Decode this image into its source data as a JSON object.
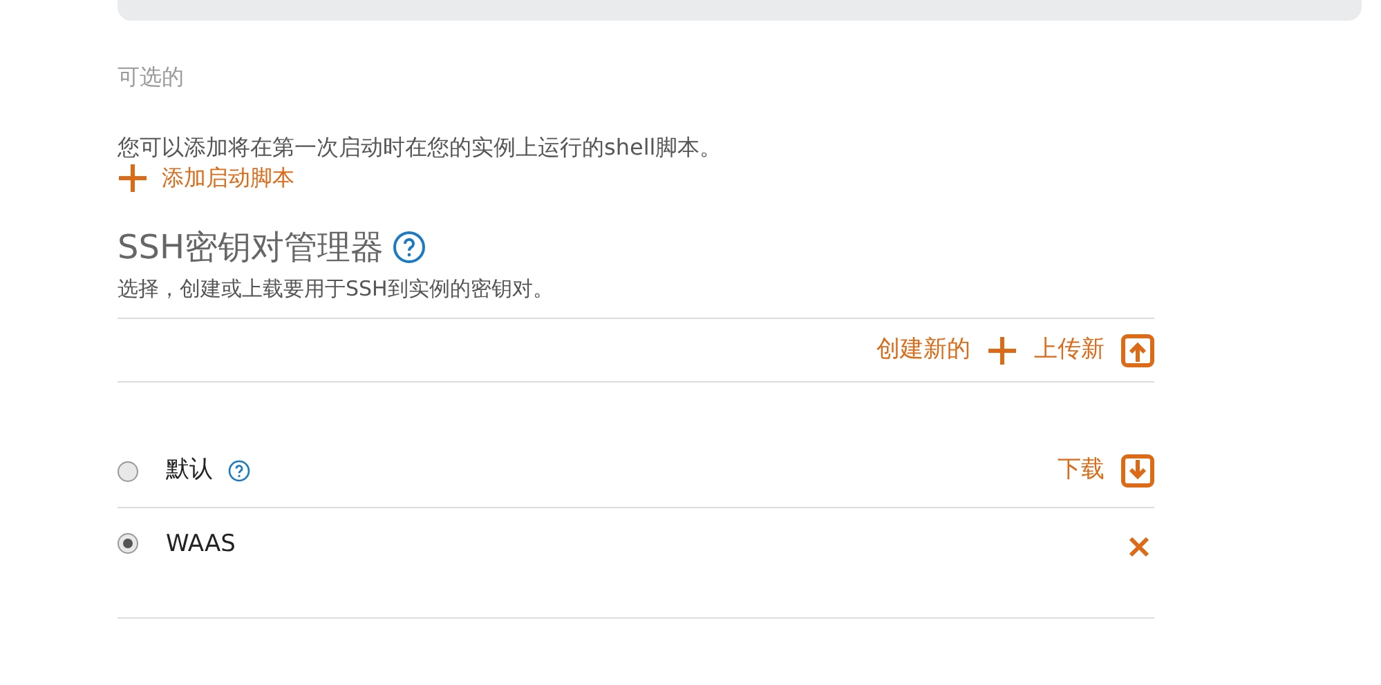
{
  "optional_label": "可选的",
  "script_section": {
    "description": "您可以添加将在第一次启动时在您的实例上运行的shell脚本。",
    "add_link": "添加启动脚本"
  },
  "ssh_section": {
    "title": "SSH密钥对管理器",
    "subtitle": "选择，创建或上载要用于SSH到实例的密钥对。",
    "create_link": "创建新的",
    "upload_link": "上传新"
  },
  "keys": [
    {
      "name": "默认",
      "selected": false,
      "help": true,
      "kind": "download",
      "action_label": "下载"
    },
    {
      "name": "WAAS",
      "selected": true,
      "help": false,
      "kind": "delete"
    }
  ]
}
